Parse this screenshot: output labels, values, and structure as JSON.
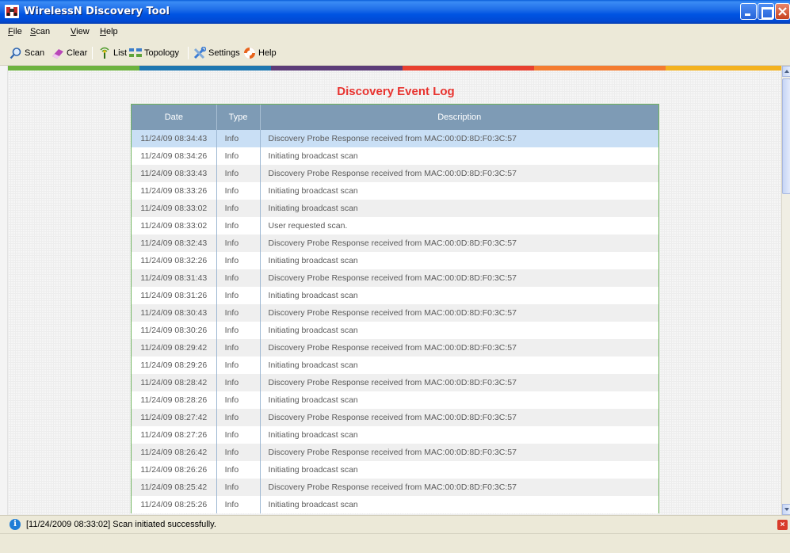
{
  "window": {
    "title": "WirelessN Discovery Tool"
  },
  "menu": [
    {
      "label": "File",
      "key": "F",
      "rest": "ile"
    },
    {
      "label": "Scan",
      "key": "S",
      "rest": "can"
    },
    {
      "label": "View",
      "key": "V",
      "rest": "iew"
    },
    {
      "label": "Help",
      "key": "H",
      "rest": "elp"
    }
  ],
  "toolbar": {
    "scan": "Scan",
    "clear": "Clear",
    "list": "List",
    "topology": "Topology",
    "settings": "Settings",
    "help": "Help"
  },
  "stripe_colors": [
    "#6DB33F",
    "#1E77B0",
    "#5C3C78",
    "#E8402F",
    "#F47C30",
    "#F3B21F"
  ],
  "log": {
    "title": "Discovery Event Log",
    "columns": [
      "Date",
      "Type",
      "Description"
    ],
    "rows": [
      [
        "11/24/09 08:34:43",
        "Info",
        "Discovery Probe Response received from MAC:00:0D:8D:F0:3C:57"
      ],
      [
        "11/24/09 08:34:26",
        "Info",
        "Initiating broadcast scan"
      ],
      [
        "11/24/09 08:33:43",
        "Info",
        "Discovery Probe Response received from MAC:00:0D:8D:F0:3C:57"
      ],
      [
        "11/24/09 08:33:26",
        "Info",
        "Initiating broadcast scan"
      ],
      [
        "11/24/09 08:33:02",
        "Info",
        "Initiating broadcast scan"
      ],
      [
        "11/24/09 08:33:02",
        "Info",
        "User requested scan."
      ],
      [
        "11/24/09 08:32:43",
        "Info",
        "Discovery Probe Response received from MAC:00:0D:8D:F0:3C:57"
      ],
      [
        "11/24/09 08:32:26",
        "Info",
        "Initiating broadcast scan"
      ],
      [
        "11/24/09 08:31:43",
        "Info",
        "Discovery Probe Response received from MAC:00:0D:8D:F0:3C:57"
      ],
      [
        "11/24/09 08:31:26",
        "Info",
        "Initiating broadcast scan"
      ],
      [
        "11/24/09 08:30:43",
        "Info",
        "Discovery Probe Response received from MAC:00:0D:8D:F0:3C:57"
      ],
      [
        "11/24/09 08:30:26",
        "Info",
        "Initiating broadcast scan"
      ],
      [
        "11/24/09 08:29:42",
        "Info",
        "Discovery Probe Response received from MAC:00:0D:8D:F0:3C:57"
      ],
      [
        "11/24/09 08:29:26",
        "Info",
        "Initiating broadcast scan"
      ],
      [
        "11/24/09 08:28:42",
        "Info",
        "Discovery Probe Response received from MAC:00:0D:8D:F0:3C:57"
      ],
      [
        "11/24/09 08:28:26",
        "Info",
        "Initiating broadcast scan"
      ],
      [
        "11/24/09 08:27:42",
        "Info",
        "Discovery Probe Response received from MAC:00:0D:8D:F0:3C:57"
      ],
      [
        "11/24/09 08:27:26",
        "Info",
        "Initiating broadcast scan"
      ],
      [
        "11/24/09 08:26:42",
        "Info",
        "Discovery Probe Response received from MAC:00:0D:8D:F0:3C:57"
      ],
      [
        "11/24/09 08:26:26",
        "Info",
        "Initiating broadcast scan"
      ],
      [
        "11/24/09 08:25:42",
        "Info",
        "Discovery Probe Response received from MAC:00:0D:8D:F0:3C:57"
      ],
      [
        "11/24/09 08:25:26",
        "Info",
        "Initiating broadcast scan"
      ]
    ],
    "selected_row": 0
  },
  "status": {
    "message": "[11/24/2009 08:33:02] Scan initiated successfully.",
    "icon": "info-icon"
  }
}
